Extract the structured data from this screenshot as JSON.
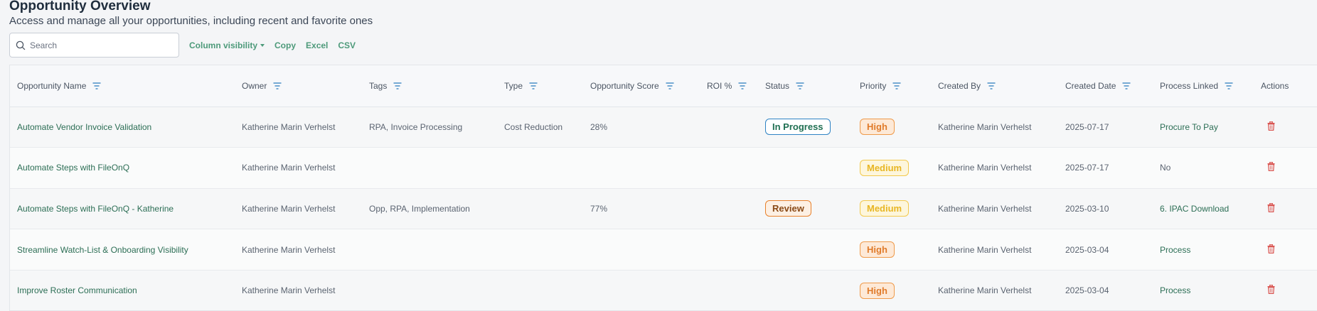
{
  "page": {
    "title": "Opportunity Overview",
    "subtitle": "Access and manage all your opportunities, including recent and favorite ones"
  },
  "toolbar": {
    "search_placeholder": "Search",
    "search_value": "",
    "column_visibility": "Column visibility",
    "copy": "Copy",
    "excel": "Excel",
    "csv": "CSV"
  },
  "table": {
    "columns": [
      "Opportunity Name",
      "Owner",
      "Tags",
      "Type",
      "Opportunity Score",
      "ROI %",
      "Status",
      "Priority",
      "Created By",
      "Created Date",
      "Process Linked",
      "Actions"
    ],
    "rows": [
      {
        "name": "Automate Vendor Invoice Validation",
        "owner": "Katherine Marin Verhelst",
        "tags": "RPA, Invoice Processing",
        "type": "Cost Reduction",
        "score": "28%",
        "roi": "",
        "status": "In Progress",
        "priority": "High",
        "created_by": "Katherine Marin Verhelst",
        "created_date": "2025-07-17",
        "process": "Procure To Pay"
      },
      {
        "name": "Automate Steps with FileOnQ",
        "owner": "Katherine Marin Verhelst",
        "tags": "",
        "type": "",
        "score": "",
        "roi": "",
        "status": "",
        "priority": "Medium",
        "created_by": "Katherine Marin Verhelst",
        "created_date": "2025-07-17",
        "process": "No"
      },
      {
        "name": "Automate Steps with FileOnQ - Katherine",
        "owner": "Katherine Marin Verhelst",
        "tags": "Opp, RPA, Implementation",
        "type": "",
        "score": "77%",
        "roi": "",
        "status": "Review",
        "priority": "Medium",
        "created_by": "Katherine Marin Verhelst",
        "created_date": "2025-03-10",
        "process": "6. IPAC Download"
      },
      {
        "name": "Streamline Watch-List & Onboarding Visibility",
        "owner": "Katherine Marin Verhelst",
        "tags": "",
        "type": "",
        "score": "",
        "roi": "",
        "status": "",
        "priority": "High",
        "created_by": "Katherine Marin Verhelst",
        "created_date": "2025-03-04",
        "process": "Process"
      },
      {
        "name": "Improve Roster Communication",
        "owner": "Katherine Marin Verhelst",
        "tags": "",
        "type": "",
        "score": "",
        "roi": "",
        "status": "",
        "priority": "High",
        "created_by": "Katherine Marin Verhelst",
        "created_date": "2025-03-04",
        "process": "Process"
      }
    ]
  },
  "colors": {
    "accent": "#4d9a7a",
    "link": "#2c6e55",
    "delete": "#d9534f"
  },
  "icons": {
    "search": "search-icon",
    "filter": "filter-icon",
    "delete": "trash-icon"
  }
}
